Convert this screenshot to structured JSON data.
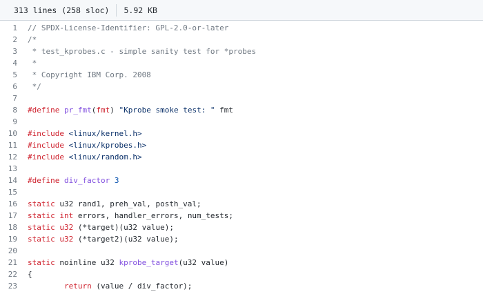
{
  "file_info": {
    "lines": "313 lines (258 sloc)",
    "size": "5.92 KB"
  },
  "code_lines": [
    {
      "n": "1",
      "tokens": [
        {
          "t": "// SPDX-License-Identifier: GPL-2.0-or-later",
          "c": "comment"
        }
      ]
    },
    {
      "n": "2",
      "tokens": [
        {
          "t": "/*",
          "c": "comment"
        }
      ]
    },
    {
      "n": "3",
      "tokens": [
        {
          "t": " * test_kprobes.c - simple sanity test for *probes",
          "c": "comment"
        }
      ]
    },
    {
      "n": "4",
      "tokens": [
        {
          "t": " *",
          "c": "comment"
        }
      ]
    },
    {
      "n": "5",
      "tokens": [
        {
          "t": " * Copyright IBM Corp. 2008",
          "c": "comment"
        }
      ]
    },
    {
      "n": "6",
      "tokens": [
        {
          "t": " */",
          "c": "comment"
        }
      ]
    },
    {
      "n": "7",
      "tokens": []
    },
    {
      "n": "8",
      "tokens": [
        {
          "t": "#define ",
          "c": "keyword"
        },
        {
          "t": "pr_fmt",
          "c": "func"
        },
        {
          "t": "(",
          "c": ""
        },
        {
          "t": "fmt",
          "c": "keyword"
        },
        {
          "t": ") ",
          "c": ""
        },
        {
          "t": "\"Kprobe smoke test: \"",
          "c": "string"
        },
        {
          "t": " fmt",
          "c": ""
        }
      ]
    },
    {
      "n": "9",
      "tokens": []
    },
    {
      "n": "10",
      "tokens": [
        {
          "t": "#include ",
          "c": "keyword"
        },
        {
          "t": "<linux/kernel.h>",
          "c": "string"
        }
      ]
    },
    {
      "n": "11",
      "tokens": [
        {
          "t": "#include ",
          "c": "keyword"
        },
        {
          "t": "<linux/kprobes.h>",
          "c": "string"
        }
      ]
    },
    {
      "n": "12",
      "tokens": [
        {
          "t": "#include ",
          "c": "keyword"
        },
        {
          "t": "<linux/random.h>",
          "c": "string"
        }
      ]
    },
    {
      "n": "13",
      "tokens": []
    },
    {
      "n": "14",
      "tokens": [
        {
          "t": "#define ",
          "c": "keyword"
        },
        {
          "t": "div_factor",
          "c": "func"
        },
        {
          "t": " ",
          "c": ""
        },
        {
          "t": "3",
          "c": "macro"
        }
      ]
    },
    {
      "n": "15",
      "tokens": []
    },
    {
      "n": "16",
      "tokens": [
        {
          "t": "static",
          "c": "keyword"
        },
        {
          "t": " u32 rand1, preh_val, posth_val;",
          "c": ""
        }
      ]
    },
    {
      "n": "17",
      "tokens": [
        {
          "t": "static",
          "c": "keyword"
        },
        {
          "t": " ",
          "c": ""
        },
        {
          "t": "int",
          "c": "keyword"
        },
        {
          "t": " errors, handler_errors, num_tests;",
          "c": ""
        }
      ]
    },
    {
      "n": "18",
      "tokens": [
        {
          "t": "static",
          "c": "keyword"
        },
        {
          "t": " ",
          "c": ""
        },
        {
          "t": "u32",
          "c": "keyword"
        },
        {
          "t": " (*target)(u32 value);",
          "c": ""
        }
      ]
    },
    {
      "n": "19",
      "tokens": [
        {
          "t": "static",
          "c": "keyword"
        },
        {
          "t": " ",
          "c": ""
        },
        {
          "t": "u32",
          "c": "keyword"
        },
        {
          "t": " (*target2)(u32 value);",
          "c": ""
        }
      ]
    },
    {
      "n": "20",
      "tokens": []
    },
    {
      "n": "21",
      "tokens": [
        {
          "t": "static",
          "c": "keyword"
        },
        {
          "t": " noinline u32 ",
          "c": ""
        },
        {
          "t": "kprobe_target",
          "c": "func"
        },
        {
          "t": "(u32 value)",
          "c": ""
        }
      ]
    },
    {
      "n": "22",
      "tokens": [
        {
          "t": "{",
          "c": ""
        }
      ]
    },
    {
      "n": "23",
      "tokens": [
        {
          "t": "        ",
          "c": ""
        },
        {
          "t": "return",
          "c": "keyword"
        },
        {
          "t": " (value / div_factor);",
          "c": ""
        }
      ]
    }
  ]
}
